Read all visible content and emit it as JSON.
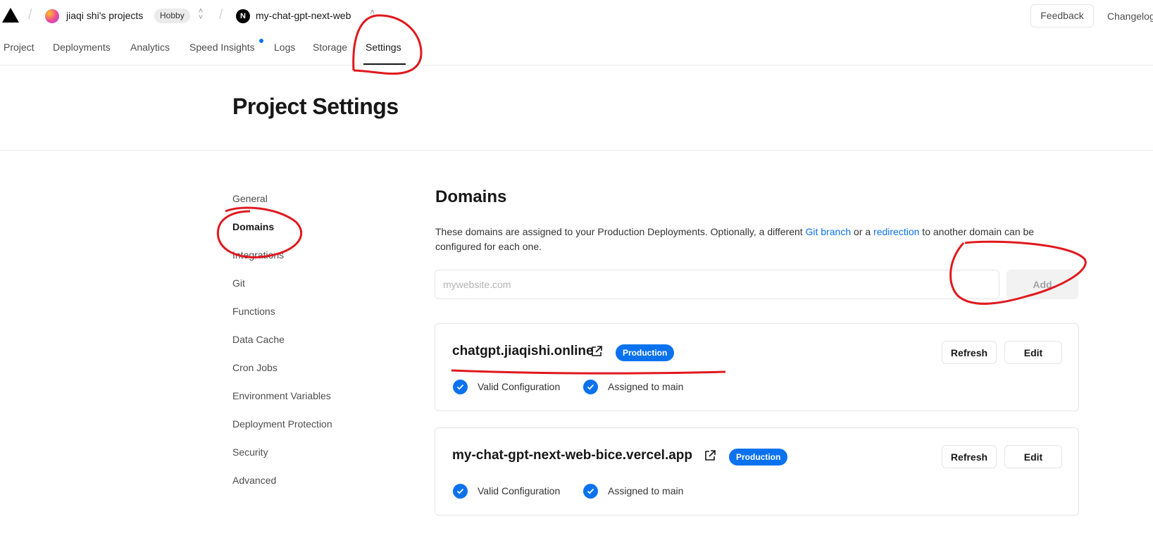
{
  "topbar": {
    "team_name": "jiaqi shi's projects",
    "plan_badge": "Hobby",
    "project_icon_letter": "N",
    "project_name": "my-chat-gpt-next-web",
    "feedback_label": "Feedback",
    "changelog_label": "Changelog"
  },
  "tabs": [
    {
      "label": "Project"
    },
    {
      "label": "Deployments"
    },
    {
      "label": "Analytics"
    },
    {
      "label": "Speed Insights"
    },
    {
      "label": "Logs"
    },
    {
      "label": "Storage"
    },
    {
      "label": "Settings",
      "active": true
    }
  ],
  "header": {
    "title": "Project Settings"
  },
  "sidebar": {
    "items": [
      {
        "label": "General"
      },
      {
        "label": "Domains",
        "active": true
      },
      {
        "label": "Integrations"
      },
      {
        "label": "Git"
      },
      {
        "label": "Functions"
      },
      {
        "label": "Data Cache"
      },
      {
        "label": "Cron Jobs"
      },
      {
        "label": "Environment Variables"
      },
      {
        "label": "Deployment Protection"
      },
      {
        "label": "Security"
      },
      {
        "label": "Advanced"
      }
    ]
  },
  "domains": {
    "title": "Domains",
    "description_part1": "These domains are assigned to your Production Deployments. Optionally, a different ",
    "link_git_branch": "Git branch",
    "description_part2": " or a ",
    "link_redirection": "redirection",
    "description_part3": " to another domain can be configured for each one.",
    "input_placeholder": "mywebsite.com",
    "input_value": "",
    "add_label": "Add",
    "list": [
      {
        "domain": "chatgpt.jiaqishi.online",
        "badge": "Production",
        "refresh_label": "Refresh",
        "edit_label": "Edit",
        "status_config": "Valid Configuration",
        "status_branch": "Assigned to main"
      },
      {
        "domain": "my-chat-gpt-next-web-bice.vercel.app",
        "badge": "Production",
        "refresh_label": "Refresh",
        "edit_label": "Edit",
        "status_config": "Valid Configuration",
        "status_branch": "Assigned to main"
      }
    ]
  },
  "colors": {
    "accent": "#0a72ef",
    "annotation": "#e0191e"
  }
}
